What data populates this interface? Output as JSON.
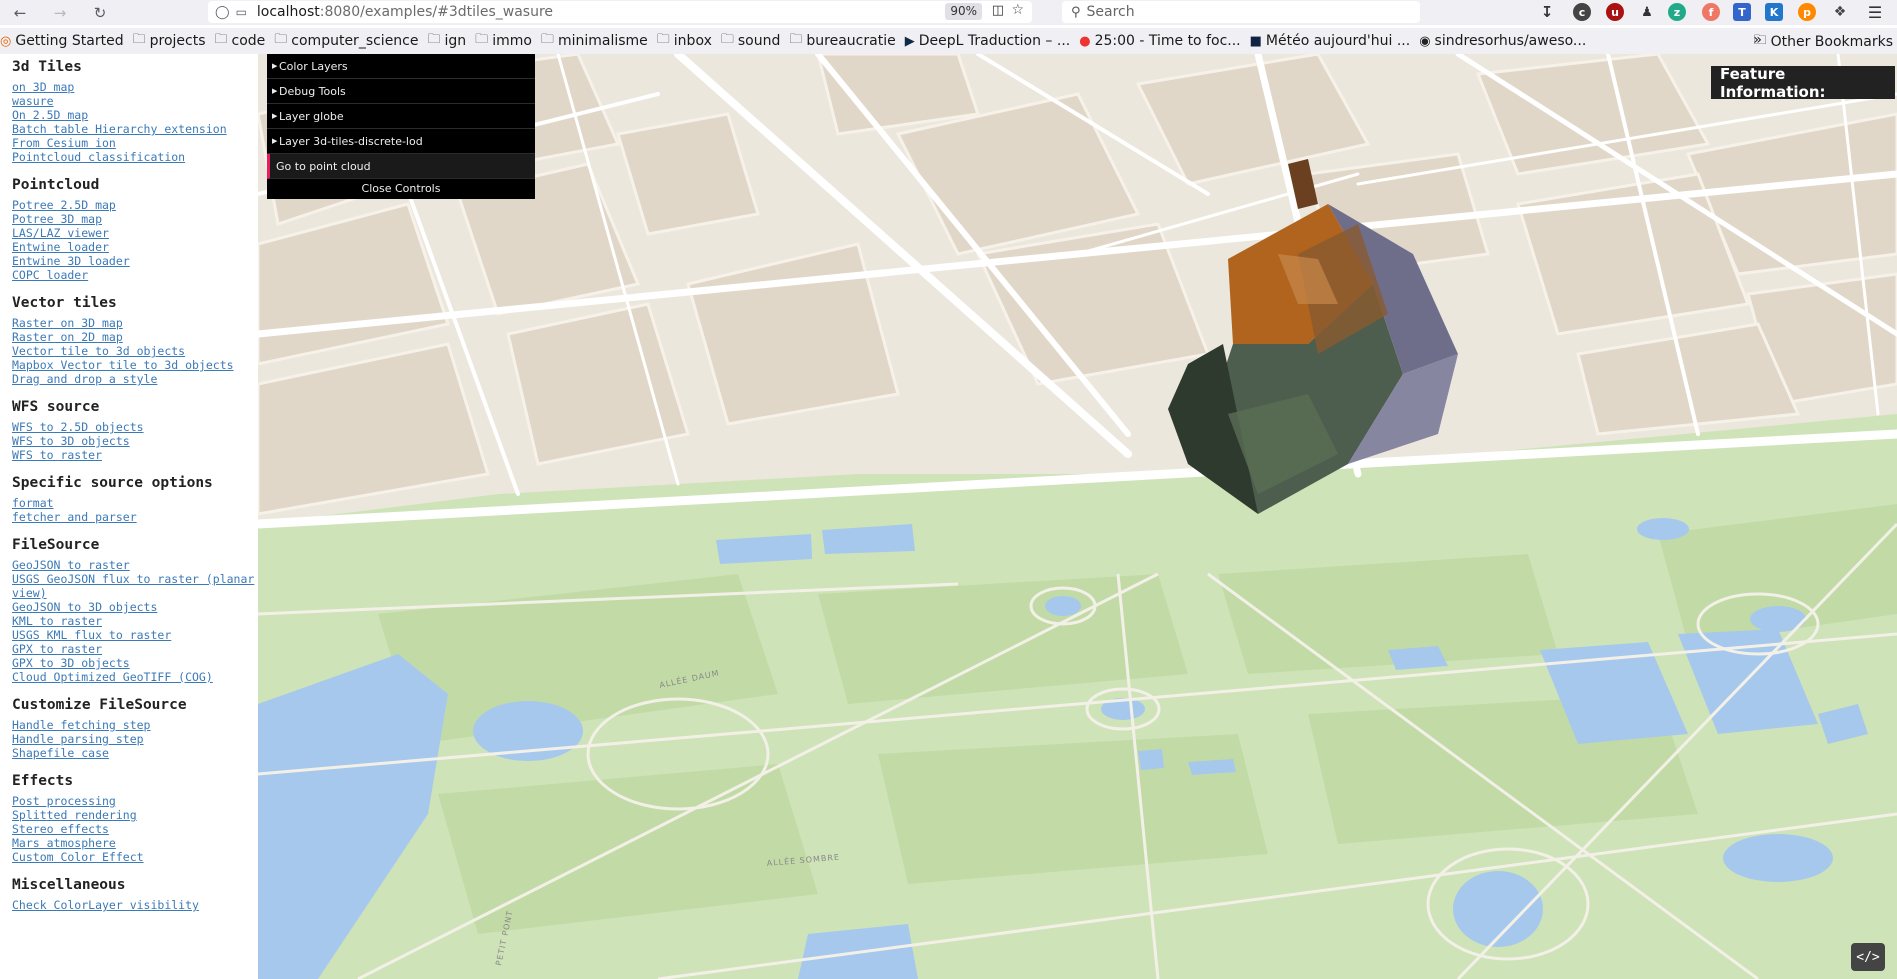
{
  "browser": {
    "url_host": "localhost",
    "url_rest": ":8080/examples/#3dtiles_wasure",
    "zoom": "90%",
    "search_placeholder": "Search"
  },
  "bookmarks": [
    {
      "label": "Getting Started",
      "icon": "firefox-icon"
    },
    {
      "label": "projects",
      "icon": "folder-icon"
    },
    {
      "label": "code",
      "icon": "folder-icon"
    },
    {
      "label": "computer_science",
      "icon": "folder-icon"
    },
    {
      "label": "ign",
      "icon": "folder-icon"
    },
    {
      "label": "immo",
      "icon": "folder-icon"
    },
    {
      "label": "minimalisme",
      "icon": "folder-icon"
    },
    {
      "label": "inbox",
      "icon": "folder-icon"
    },
    {
      "label": "sound",
      "icon": "folder-icon"
    },
    {
      "label": "bureaucratie",
      "icon": "folder-icon"
    },
    {
      "label": "DeepL Traduction – ...",
      "icon": "deepl-icon"
    },
    {
      "label": "25:00 - Time to foc...",
      "icon": "tomato-icon"
    },
    {
      "label": "Météo aujourd'hui ...",
      "icon": "meteoblue-icon"
    },
    {
      "label": "sindresorhus/aweso...",
      "icon": "github-icon"
    }
  ],
  "bookmarks_other": "Other Bookmarks",
  "sidebar": [
    {
      "title": "3d Tiles",
      "links": [
        "on 3D map",
        "wasure",
        "On 2.5D map",
        "Batch table Hierarchy extension",
        "From Cesium ion",
        "Pointcloud classification"
      ]
    },
    {
      "title": "Pointcloud",
      "links": [
        "Potree 2.5D map",
        "Potree 3D map",
        "LAS/LAZ viewer",
        "Entwine loader",
        "Entwine 3D loader",
        "COPC loader"
      ]
    },
    {
      "title": "Vector tiles",
      "links": [
        "Raster on 3D map",
        "Raster on 2D map",
        "Vector tile to 3d objects",
        "Mapbox Vector tile to 3d objects",
        "Drag and drop a style"
      ]
    },
    {
      "title": "WFS source",
      "links": [
        "WFS to 2.5D objects",
        "WFS to 3D objects",
        "WFS to raster"
      ]
    },
    {
      "title": "Specific source options",
      "links": [
        "format",
        "fetcher and parser"
      ]
    },
    {
      "title": "FileSource",
      "links": [
        "GeoJSON to raster",
        "USGS GeoJSON flux to raster (planar view)",
        "GeoJSON to 3D objects",
        "KML to raster",
        "USGS KML flux to raster",
        "GPX to raster",
        "GPX to 3D objects",
        "Cloud Optimized GeoTIFF (COG)"
      ]
    },
    {
      "title": "Customize FileSource",
      "links": [
        "Handle fetching step",
        "Handle parsing step",
        "Shapefile case"
      ]
    },
    {
      "title": "Effects",
      "links": [
        "Post processing",
        "Splitted rendering",
        "Stereo effects",
        "Mars atmosphere",
        "Custom Color Effect"
      ]
    },
    {
      "title": "Miscellaneous",
      "links": [
        "Check ColorLayer visibility"
      ]
    }
  ],
  "gui": {
    "folders": [
      "Color Layers",
      "Debug Tools",
      "Layer globe",
      "Layer 3d-tiles-discrete-lod"
    ],
    "button": "Go to point cloud",
    "close": "Close Controls"
  },
  "feature_info": "Feature Information:",
  "map_labels": [
    "ALLÉE DAUM",
    "ALLÉE SOMBRE",
    "PETIT PONT"
  ],
  "colors": {
    "map_bg": "#ece7dc",
    "park": "#cfe3b8",
    "water": "#a6c8ec",
    "road": "#ffffff",
    "block": "#e1d7c8",
    "gui_accent": "#e61d5f",
    "link": "#3b7ab8"
  }
}
